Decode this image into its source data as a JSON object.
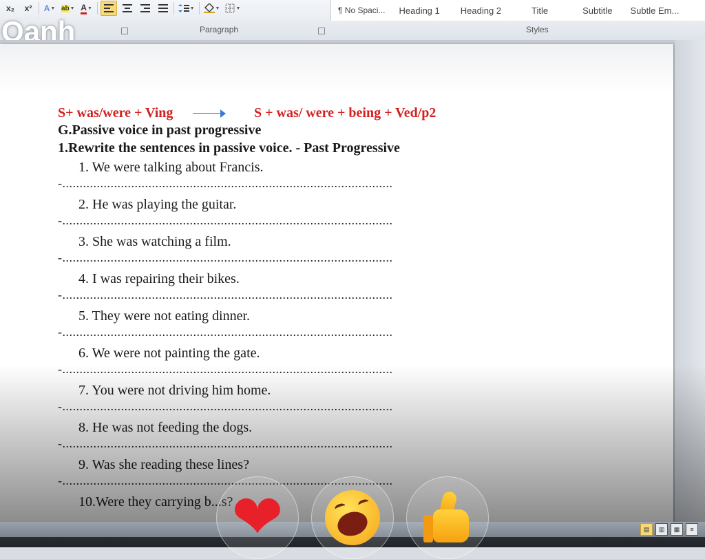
{
  "ribbon": {
    "font_tools": [
      "x₂",
      "x²",
      "A",
      "ab",
      "A"
    ],
    "para_tools": [
      "align-left",
      "align-center",
      "align-right",
      "justify",
      "line-spacing",
      "shading",
      "borders"
    ],
    "paragraph_label": "Paragraph",
    "styles_label": "Styles",
    "styles": [
      "¶ No Spaci...",
      "Heading 1",
      "Heading 2",
      "Title",
      "Subtitle",
      "Subtle Em..."
    ]
  },
  "overlay_name": "Oanh",
  "document": {
    "formula_left": "S+ was/were + Ving",
    "formula_right": "S + was/ were + being + Ved/p2",
    "heading_g": "G.Passive voice in past progressive",
    "heading_task": "1.Rewrite the sentences in passive voice. - Past Progressive",
    "answer_line": "-................................................................................................",
    "exercises": [
      "1. We were talking about Francis.",
      "2. He was playing the guitar.",
      "3. She was watching a film.",
      "4. I was repairing their bikes.",
      "5. They were not eating dinner.",
      "6. We were not painting the gate.",
      "7. You were not driving him home.",
      "8. He was not feeding the dogs.",
      "9. Was she reading these lines?",
      "10.Were they carrying b...s?"
    ]
  },
  "reactions": [
    "heart",
    "laughing",
    "thumbs-up"
  ],
  "colors": {
    "formula": "#d42020",
    "arrow": "#3a7ad0",
    "heart": "#e8202a",
    "active_tool": "#f7d97a"
  }
}
